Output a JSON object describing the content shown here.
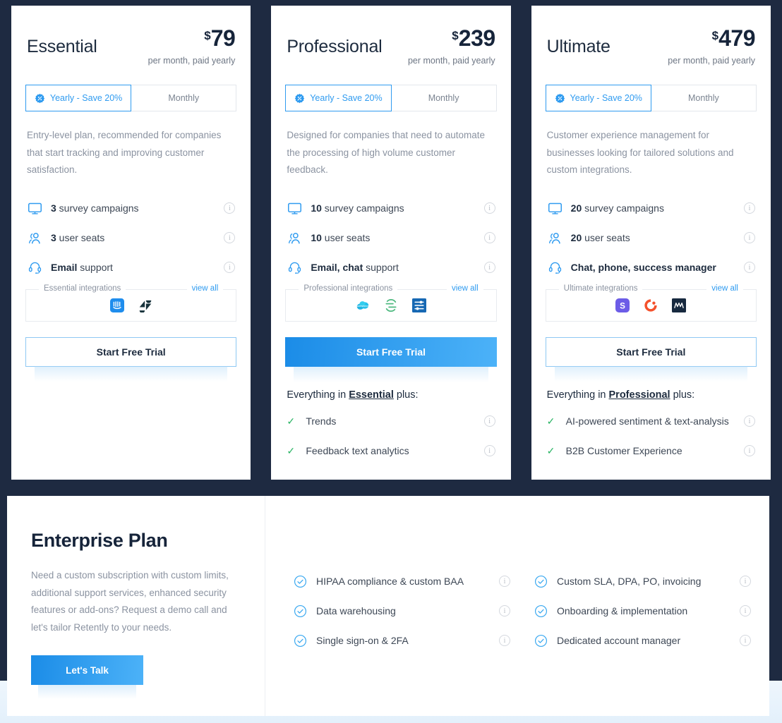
{
  "plans": [
    {
      "id": "essential",
      "name": "Essential",
      "currency": "$",
      "price": "79",
      "price_note": "per month, paid yearly",
      "billing": {
        "yearly_label": "Yearly - Save 20%",
        "monthly_label": "Monthly",
        "selected": "yearly",
        "badge_icon": "percent-badge-icon"
      },
      "description": "Entry-level plan, recommended for companies that start tracking and improving customer satisfaction.",
      "features": [
        {
          "icon": "monitor-icon",
          "strong": "3",
          "text": " survey campaigns",
          "info": "i"
        },
        {
          "icon": "users-icon",
          "strong": "3",
          "text": " user seats",
          "info": "i"
        },
        {
          "icon": "headset-icon",
          "strong": "Email",
          "text": " support",
          "info": "i"
        }
      ],
      "integrations": {
        "legend": "Essential integrations",
        "view_all": "view all",
        "icons": [
          "intercom-icon",
          "zendesk-icon"
        ]
      },
      "cta": {
        "label": "Start Free Trial",
        "style": "outline"
      },
      "everything_in": null,
      "plus_features": []
    },
    {
      "id": "professional",
      "name": "Professional",
      "currency": "$",
      "price": "239",
      "price_note": "per month, paid yearly",
      "billing": {
        "yearly_label": "Yearly - Save 20%",
        "monthly_label": "Monthly",
        "selected": "yearly",
        "badge_icon": "percent-badge-icon"
      },
      "description": "Designed for companies that need to automate the processing of high volume customer feedback.",
      "features": [
        {
          "icon": "monitor-icon",
          "strong": "10",
          "text": " survey campaigns",
          "info": "i"
        },
        {
          "icon": "users-icon",
          "strong": "10",
          "text": " user seats",
          "info": "i"
        },
        {
          "icon": "headset-icon",
          "strong": "Email, chat",
          "text": " support",
          "info": "i"
        }
      ],
      "integrations": {
        "legend": "Professional integrations",
        "view_all": "view all",
        "icons": [
          "salesforce-icon",
          "segment-icon",
          "hubspot-icon"
        ]
      },
      "cta": {
        "label": "Start Free Trial",
        "style": "filled"
      },
      "everything_in": {
        "prefix": "Everything in ",
        "plan": "Essential",
        "suffix": " plus:"
      },
      "plus_features": [
        {
          "text": "Trends",
          "info": "i"
        },
        {
          "text": "Feedback text analytics",
          "info": "i"
        }
      ]
    },
    {
      "id": "ultimate",
      "name": "Ultimate",
      "currency": "$",
      "price": "479",
      "price_note": "per month, paid yearly",
      "billing": {
        "yearly_label": "Yearly - Save 20%",
        "monthly_label": "Monthly",
        "selected": "yearly",
        "badge_icon": "percent-badge-icon"
      },
      "description": "Customer experience management for businesses looking for tailored solutions and custom integrations.",
      "features": [
        {
          "icon": "monitor-icon",
          "strong": "20",
          "text": " survey campaigns",
          "info": "i"
        },
        {
          "icon": "users-icon",
          "strong": "20",
          "text": " user seats",
          "info": "i"
        },
        {
          "icon": "headset-icon",
          "strong": "Chat, phone, success manager",
          "text": "",
          "info": "i"
        }
      ],
      "integrations": {
        "legend": "Ultimate integrations",
        "view_all": "view all",
        "icons": [
          "slack-icon",
          "clickup-icon",
          "mixpanel-icon"
        ]
      },
      "cta": {
        "label": "Start Free Trial",
        "style": "outline"
      },
      "everything_in": {
        "prefix": "Everything in ",
        "plan": "Professional",
        "suffix": " plus:"
      },
      "plus_features": [
        {
          "text": "AI-powered sentiment & text-analysis",
          "info": "i"
        },
        {
          "text": "B2B Customer Experience",
          "info": "i"
        }
      ]
    }
  ],
  "enterprise": {
    "title": "Enterprise Plan",
    "description": "Need a custom subscription with custom limits, additional support services, enhanced security features or add-ons? Request a demo call and let's tailor Retently to your needs.",
    "button_label": "Let's Talk",
    "columns": [
      [
        {
          "text": "HIPAA compliance & custom BAA",
          "info": "i"
        },
        {
          "text": "Data warehousing",
          "info": "i"
        },
        {
          "text": "Single sign-on & 2FA",
          "info": "i"
        }
      ],
      [
        {
          "text": "Custom SLA, DPA, PO, invoicing",
          "info": "i"
        },
        {
          "text": "Onboarding & implementation",
          "info": "i"
        },
        {
          "text": "Dedicated account manager",
          "info": "i"
        }
      ]
    ]
  },
  "colors": {
    "page_background": "#1e2a41",
    "accent_blue": "#2f9bf0",
    "cta_gradient_start": "#1b8ce7",
    "cta_gradient_end": "#4cb2f8",
    "check_green": "#28b463",
    "heading": "#16243a",
    "muted_text": "#8b93a1"
  }
}
